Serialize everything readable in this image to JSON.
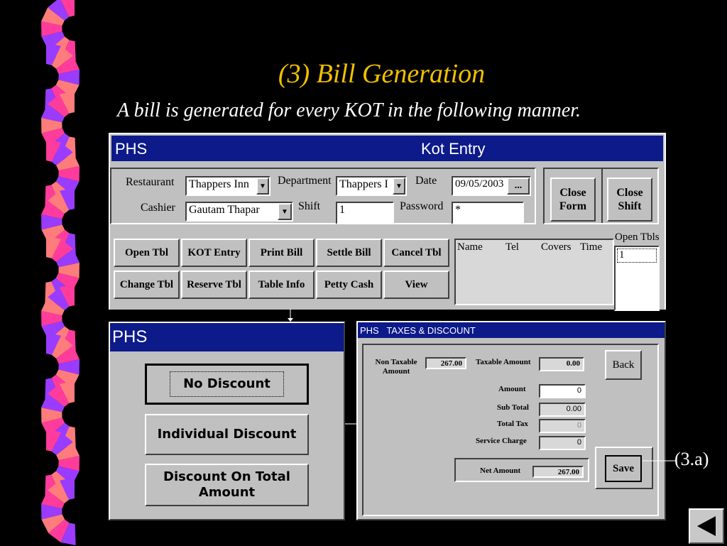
{
  "slide": {
    "title": "(3) Bill Generation",
    "subtitle": "A bill is generated for every KOT in the following manner.",
    "callout_label": "(3.a)"
  },
  "kot_window": {
    "app_name": "PHS",
    "title": "Kot Entry",
    "restaurant_label": "Restaurant",
    "restaurant_value": "Thappers Inn",
    "department_label": "Department",
    "department_value": "Thappers I",
    "date_label": "Date",
    "date_value": "09/05/2003",
    "date_button": "...",
    "cashier_label": "Cashier",
    "cashier_value": "Gautam Thapar",
    "shift_label": "Shift",
    "shift_value": "1",
    "password_label": "Password",
    "password_value": "*",
    "close_form": "Close Form",
    "close_shift": "Close Shift",
    "buttons": [
      "Open Tbl",
      "KOT Entry",
      "Print Bill",
      "Settle Bill",
      "Cancel Tbl",
      "Change Tbl",
      "Reserve Tbl",
      "Table Info",
      "Petty Cash",
      "View"
    ],
    "list_columns": [
      "Name",
      "Tel",
      "Covers",
      "Time"
    ],
    "open_tbls_label": "Open Tbls",
    "open_tbls_items": [
      "1"
    ]
  },
  "discount_window": {
    "title": "PHS",
    "options": [
      "No Discount",
      "Individual Discount",
      "Discount On Total Amount"
    ]
  },
  "tax_window": {
    "title": "PHS   TAXES & DISCOUNT",
    "non_taxable_label": "Non Taxable Amount",
    "non_taxable_value": "267.00",
    "taxable_label": "Taxable Amount",
    "taxable_value": "0.00",
    "amount_label": "Amount",
    "amount_value": "0",
    "sub_total_label": "Sub Total",
    "sub_total_value": "0.00",
    "total_tax_label": "Total Tax",
    "total_tax_value": "0",
    "service_charge_label": "Service Charge",
    "service_charge_value": "0",
    "net_amount_label": "Net Amount",
    "net_amount_value": "267.00",
    "back_label": "Back",
    "save_label": "Save"
  },
  "nav": {
    "back_icon": "left-arrow-icon"
  },
  "colors": {
    "title": "#f0c000",
    "titlebar": "#0c1a8a",
    "ribbon_pink": "#ff3c9c",
    "ribbon_purple": "#9a3cff",
    "ribbon_salmon": "#ff7c7c"
  }
}
